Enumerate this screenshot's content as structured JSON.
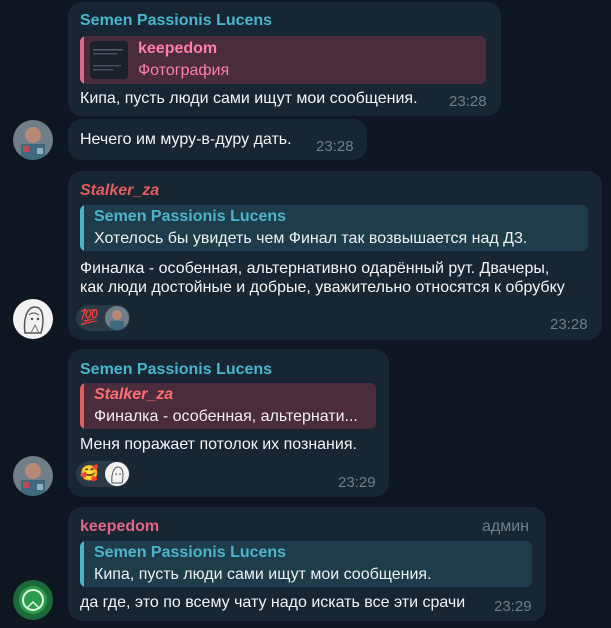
{
  "colors": {
    "background": "#0e1621",
    "bubble": "#182533",
    "cyan_name": "#49b6cc",
    "pink_name": "#e0668a",
    "orange_name": "#e45d5d",
    "time": "#6d7f8f"
  },
  "messages": [
    {
      "sender": "Semen Passionis Lucens",
      "reply": {
        "name": "keepedom",
        "text": "Фотография",
        "thumbnail": "photo-thumbnail"
      },
      "text": "Кипа, пусть люди сами ищут мои сообщения.",
      "time": "23:28"
    },
    {
      "text": "Нечего им муру-в-дуру дать.",
      "time": "23:28",
      "avatar": "user-avatar-semen"
    },
    {
      "sender": "Stalker_za",
      "reply": {
        "name": "Semen Passionis Lucens",
        "text": "Хотелось бы увидеть чем Финал так возвышается над Д3."
      },
      "text_lines": [
        "Финалка - особенная, альтернативно одарённый рут. Двачеры,",
        "как люди достойные и добрые, уважительно относятся к обрубку"
      ],
      "reaction": {
        "emoji": "💯",
        "avatar": "reactor-avatar"
      },
      "time": "23:28",
      "avatar": "user-avatar-stalker"
    },
    {
      "sender": "Semen Passionis Lucens",
      "reply": {
        "name": "Stalker_za",
        "text": "Финалка - особенная, альтернати..."
      },
      "text": "Меня поражает потолок их познания.",
      "reaction": {
        "emoji": "🥰",
        "avatar": "reactor-avatar"
      },
      "time": "23:29",
      "avatar": "user-avatar-semen"
    },
    {
      "sender": "keepedom",
      "role": "админ",
      "reply": {
        "name": "Semen Passionis Lucens",
        "text": "Кипа, пусть люди сами ищут мои сообщения."
      },
      "text": "да где, это по всему чату надо искать все эти срачи",
      "time": "23:29",
      "avatar": "user-avatar-keepedom"
    }
  ]
}
